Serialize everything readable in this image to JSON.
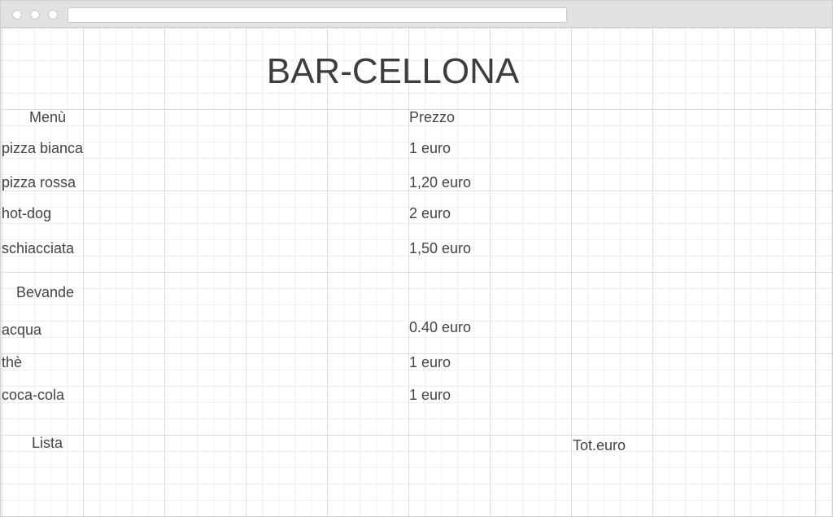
{
  "page": {
    "title": "BAR-CELLONA"
  },
  "menu": {
    "header": "Menù",
    "price_header": "Prezzo",
    "items": [
      {
        "name": "pizza bianca",
        "price": "1 euro"
      },
      {
        "name": "pizza rossa",
        "price": "1,20 euro"
      },
      {
        "name": "hot-dog",
        "price": "2 euro"
      },
      {
        "name": "schiacciata",
        "price": "1,50 euro"
      }
    ]
  },
  "drinks": {
    "header": "Bevande",
    "items": [
      {
        "name": "acqua",
        "price": "0.40 euro"
      },
      {
        "name": "thè",
        "price": "1 euro"
      },
      {
        "name": "coca-cola",
        "price": "1 euro"
      }
    ]
  },
  "footer": {
    "list_label": "Lista",
    "total_label": "Tot.euro"
  }
}
